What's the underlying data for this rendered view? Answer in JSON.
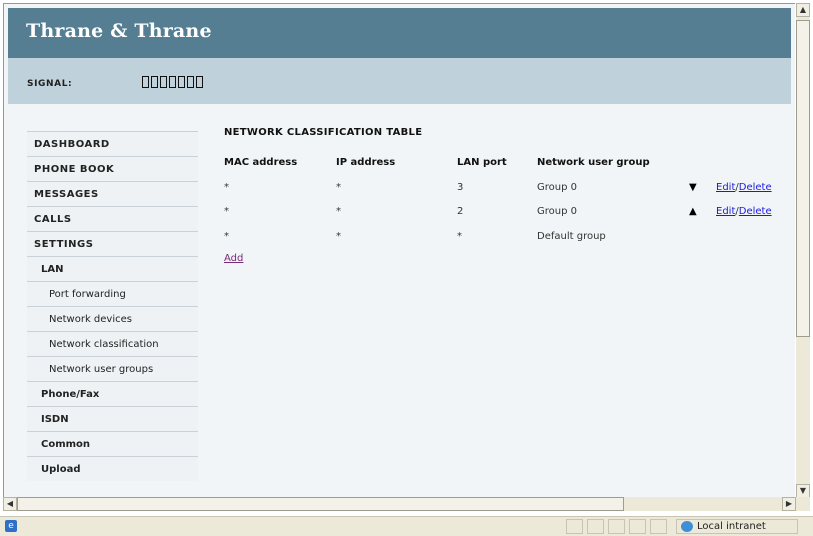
{
  "header": {
    "brand": "Thrane & Thrane"
  },
  "signal": {
    "label": "SIGNAL:",
    "bars_filled": 0,
    "bars_total": 7
  },
  "nav": {
    "items": [
      {
        "label": "DASHBOARD",
        "level": "main"
      },
      {
        "label": "PHONE BOOK",
        "level": "main"
      },
      {
        "label": "MESSAGES",
        "level": "main"
      },
      {
        "label": "CALLS",
        "level": "main"
      },
      {
        "label": "SETTINGS",
        "level": "main"
      },
      {
        "label": "LAN",
        "level": "sub1"
      },
      {
        "label": "Port forwarding",
        "level": "sub2"
      },
      {
        "label": "Network devices",
        "level": "sub2"
      },
      {
        "label": "Network classification",
        "level": "sub2"
      },
      {
        "label": "Network user groups",
        "level": "sub2"
      },
      {
        "label": "Phone/Fax",
        "level": "sub1"
      },
      {
        "label": "ISDN",
        "level": "sub1"
      },
      {
        "label": "Common",
        "level": "sub1"
      },
      {
        "label": "Upload",
        "level": "sub1"
      }
    ]
  },
  "table": {
    "title": "NETWORK CLASSIFICATION TABLE",
    "columns": [
      "MAC address",
      "IP address",
      "LAN port",
      "Network user group"
    ],
    "rows": [
      {
        "mac": "*",
        "ip": "*",
        "port": "3",
        "group": "Group 0",
        "arrow": "▼",
        "edit": "Edit",
        "sep": "/",
        "delete": "Delete"
      },
      {
        "mac": "*",
        "ip": "*",
        "port": "2",
        "group": "Group 0",
        "arrow": "▲",
        "edit": "Edit",
        "sep": "/",
        "delete": "Delete"
      },
      {
        "mac": "*",
        "ip": "*",
        "port": "*",
        "group": "Default group",
        "arrow": "",
        "edit": "",
        "sep": "",
        "delete": ""
      }
    ],
    "add_label": "Add"
  },
  "statusbar": {
    "zone": "Local intranet"
  },
  "colors": {
    "header_bg": "#557e93",
    "signal_bg": "#bfd1da",
    "content_bg": "#f1f5f7",
    "link": "#1a1adb"
  }
}
